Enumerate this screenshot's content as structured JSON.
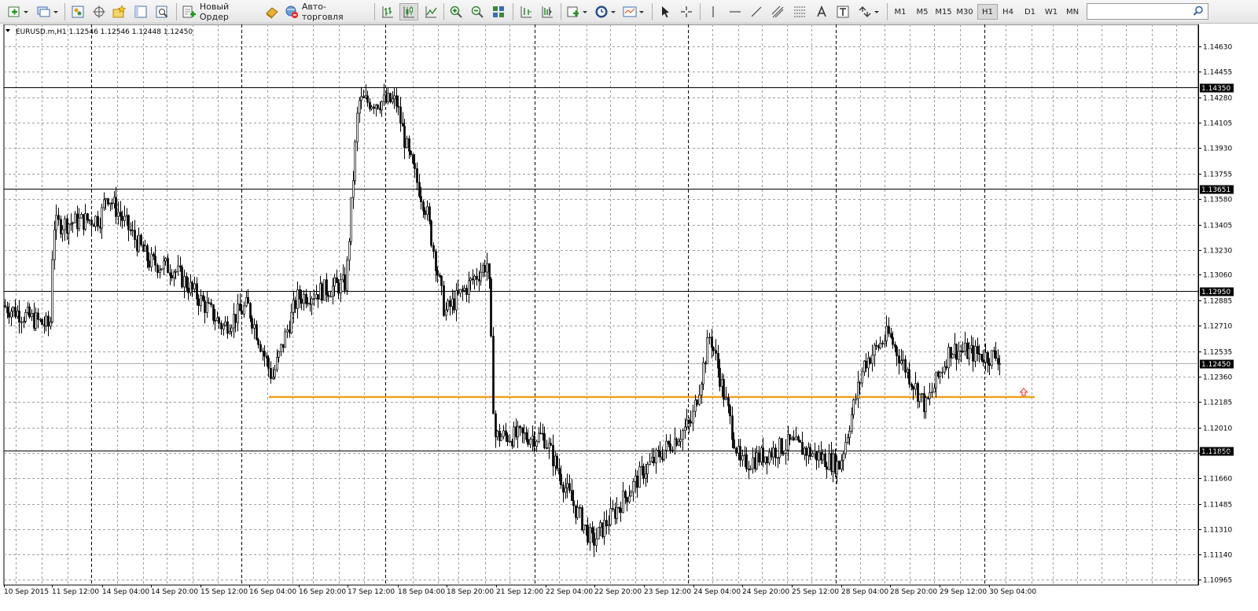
{
  "toolbar": {
    "new_order_label": "Новый Ордер",
    "autotrading_label": "Авто-торговля",
    "timeframes": [
      "M1",
      "M5",
      "M15",
      "M30",
      "H1",
      "H4",
      "D1",
      "W1",
      "MN"
    ],
    "active_timeframe": "H1"
  },
  "chart": {
    "symbol_header": "EURUSD.m,H1  1.12546 1.12546 1.12448 1.12450",
    "colors": {
      "candle": "#000000",
      "grid": "#9e9e9e",
      "support_line": "#f0a020",
      "level_lines": "#000000",
      "arrow": "#ff2020"
    }
  },
  "chart_data": {
    "type": "candlestick",
    "symbol": "EURUSD.m",
    "timeframe": "H1",
    "ohlc_header": {
      "open": 1.12546,
      "high": 1.12546,
      "low": 1.12448,
      "close": 1.1245
    },
    "y_range": [
      1.10965,
      1.1463
    ],
    "y_ticks": [
      "1.14630",
      "1.14455",
      "1.14280",
      "1.14105",
      "1.13930",
      "1.13755",
      "1.13580",
      "1.13405",
      "1.13230",
      "1.13060",
      "1.12885",
      "1.12710",
      "1.12535",
      "1.12360",
      "1.12185",
      "1.12010",
      "1.11835",
      "1.11660",
      "1.11485",
      "1.11310",
      "1.11140",
      "1.10965"
    ],
    "x_labels": [
      "10 Sep 2015",
      "11 Sep 12:00",
      "14 Sep 04:00",
      "14 Sep 20:00",
      "15 Sep 12:00",
      "16 Sep 04:00",
      "16 Sep 20:00",
      "17 Sep 12:00",
      "18 Sep 04:00",
      "18 Sep 20:00",
      "21 Sep 12:00",
      "22 Sep 04:00",
      "22 Sep 20:00",
      "23 Sep 12:00",
      "24 Sep 04:00",
      "24 Sep 20:00",
      "25 Sep 12:00",
      "28 Sep 04:00",
      "28 Sep 20:00",
      "29 Sep 12:00",
      "30 Sep 04:00"
    ],
    "horizontal_levels": [
      {
        "price": 1.1435,
        "label": "1.14350"
      },
      {
        "price": 1.13651,
        "label": "1.13651"
      },
      {
        "price": 1.1295,
        "label": "1.12950"
      },
      {
        "price": 1.1185,
        "label": "1.11850"
      }
    ],
    "current_price": {
      "price": 1.1245,
      "label": "1.12450"
    },
    "support_line": {
      "price": 1.1222,
      "from": "16 Sep 04:00",
      "to": "30 Sep 20:00"
    },
    "price_path": [
      [
        "10 Sep 2015",
        1.1285
      ],
      [
        "11 Sep 00:00",
        1.1275
      ],
      [
        "11 Sep 12:00",
        1.127
      ],
      [
        "11 Sep 16:00",
        1.134
      ],
      [
        "14 Sep 04:00",
        1.1345
      ],
      [
        "14 Sep 06:00",
        1.1362
      ],
      [
        "14 Sep 20:00",
        1.1315
      ],
      [
        "15 Sep 04:00",
        1.131
      ],
      [
        "15 Sep 12:00",
        1.129
      ],
      [
        "15 Sep 20:00",
        1.127
      ],
      [
        "16 Sep 04:00",
        1.1285
      ],
      [
        "16 Sep 12:00",
        1.1235
      ],
      [
        "16 Sep 20:00",
        1.129
      ],
      [
        "17 Sep 12:00",
        1.13
      ],
      [
        "17 Sep 16:00",
        1.1425
      ],
      [
        "18 Sep 04:00",
        1.1425
      ],
      [
        "18 Sep 08:00",
        1.1388
      ],
      [
        "18 Sep 14:00",
        1.135
      ],
      [
        "18 Sep 20:00",
        1.128
      ],
      [
        "21 Sep 04:00",
        1.1315
      ],
      [
        "21 Sep 12:00",
        1.1195
      ],
      [
        "22 Sep 04:00",
        1.1195
      ],
      [
        "22 Sep 12:00",
        1.1155
      ],
      [
        "22 Sep 20:00",
        1.1122
      ],
      [
        "23 Sep 12:00",
        1.117
      ],
      [
        "24 Sep 04:00",
        1.1205
      ],
      [
        "24 Sep 10:00",
        1.1265
      ],
      [
        "24 Sep 20:00",
        1.1175
      ],
      [
        "25 Sep 12:00",
        1.119
      ],
      [
        "28 Sep 04:00",
        1.1175
      ],
      [
        "28 Sep 12:00",
        1.1245
      ],
      [
        "28 Sep 20:00",
        1.1265
      ],
      [
        "29 Sep 08:00",
        1.1215
      ],
      [
        "29 Sep 16:00",
        1.1255
      ],
      [
        "30 Sep 04:00",
        1.125
      ]
    ]
  }
}
